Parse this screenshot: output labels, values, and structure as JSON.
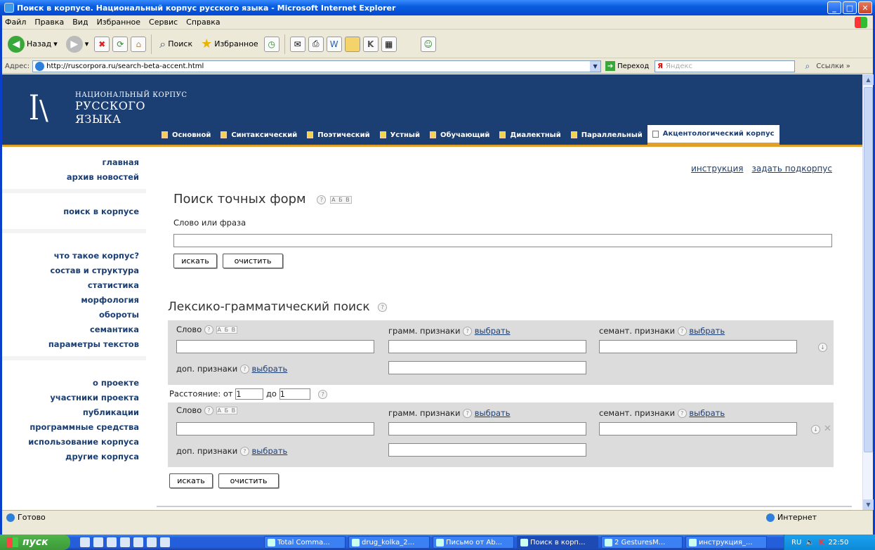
{
  "window": {
    "title": "Поиск в корпусе. Национальный корпус русского языка - Microsoft Internet Explorer"
  },
  "menubar": [
    "Файл",
    "Правка",
    "Вид",
    "Избранное",
    "Сервис",
    "Справка"
  ],
  "toolbar": {
    "back": "Назад",
    "search": "Поиск",
    "favorites": "Избранное"
  },
  "addressbar": {
    "label": "Адрес:",
    "url": "http://ruscorpora.ru/search-beta-accent.html",
    "go": "Переход",
    "yandex_placeholder": "Яндекс",
    "links": "Ссылки"
  },
  "site": {
    "logo_line1": "НАЦИОНАЛЬНЫЙ КОРПУС",
    "logo_line2": "РУССКОГО",
    "logo_line3": "ЯЗЫКА",
    "tabs": [
      {
        "label": "Основной"
      },
      {
        "label": "Синтаксический"
      },
      {
        "label": "Поэтический"
      },
      {
        "label": "Устный"
      },
      {
        "label": "Обучающий"
      },
      {
        "label": "Диалектный"
      },
      {
        "label": "Параллельный"
      },
      {
        "label": "Акцентологический корпус"
      }
    ]
  },
  "leftnav": {
    "group1": [
      "главная",
      "архив новостей"
    ],
    "group2": [
      "поиск в корпусе"
    ],
    "group3": [
      "что такое корпус?",
      "состав и структура",
      "статистика",
      "морфология",
      "обороты",
      "семантика",
      "параметры текстов"
    ],
    "group4": [
      "о проекте",
      "участники проекта",
      "публикации",
      "программные средства",
      "использование корпуса",
      "другие корпуса"
    ]
  },
  "main": {
    "link_instruction": "инструкция",
    "link_subcorpus": "задать подкорпус",
    "exact": {
      "title": "Поиск точных форм",
      "field_label": "Слово или фраза",
      "search_btn": "искать",
      "clear_btn": "очистить"
    },
    "lexgram": {
      "title": "Лексико-грамматический поиск",
      "word_label": "Слово",
      "gram_label": "грамм. признаки",
      "sem_label": "семант. признаки",
      "extra_label": "доп. признаки",
      "choose": "выбрать",
      "distance_label": "Расстояние: от",
      "distance_to": "до",
      "distance_from_val": "1",
      "distance_to_val": "1",
      "search_btn": "искать",
      "clear_btn": "очистить"
    },
    "abv": "А Б В"
  },
  "statusbar": {
    "status": "Готово",
    "zone": "Интернет"
  },
  "taskbar": {
    "start": "пуск",
    "tasks": [
      "Total Comma...",
      "drug_kolka_2...",
      "Письмо от Ab...",
      "Поиск в корп...",
      "2 GesturesM...",
      "инструкция_..."
    ],
    "lang": "RU",
    "time": "22:50"
  },
  "colors": {
    "header_bg": "#1c3f73",
    "accent": "#e0a02a",
    "xp_blue": "#0a5ee0"
  }
}
